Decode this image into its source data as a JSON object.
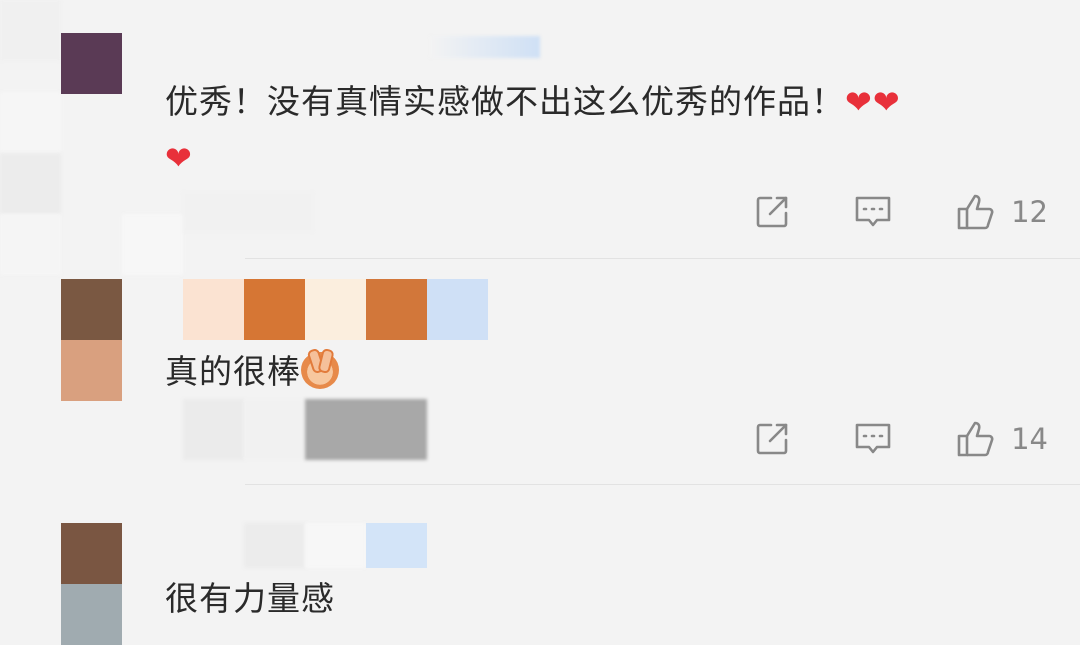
{
  "comments": [
    {
      "text": "优秀！没有真情实感做不出这么优秀的作品！",
      "emoji_hearts_line1": "❤❤",
      "emoji_hearts_line2": "❤",
      "likes": "12"
    },
    {
      "text": "真的很棒",
      "emoji": "victory-hand-emoji",
      "likes": "14"
    },
    {
      "text": "很有力量感"
    }
  ],
  "icons": {
    "share": "share-icon",
    "reply": "comment-icon",
    "like": "thumbs-up-icon"
  },
  "colors": {
    "background": "#f3f3f3",
    "text": "#2a2a2a",
    "muted": "#888888",
    "heart": "#e8303a",
    "avatar1": "#5a3a55",
    "avatar2_top": "#7a5842",
    "avatar2_bottom": "#d9a07f",
    "avatar3_top": "#7a5642",
    "avatar3_bottom": "#a0abb0"
  }
}
